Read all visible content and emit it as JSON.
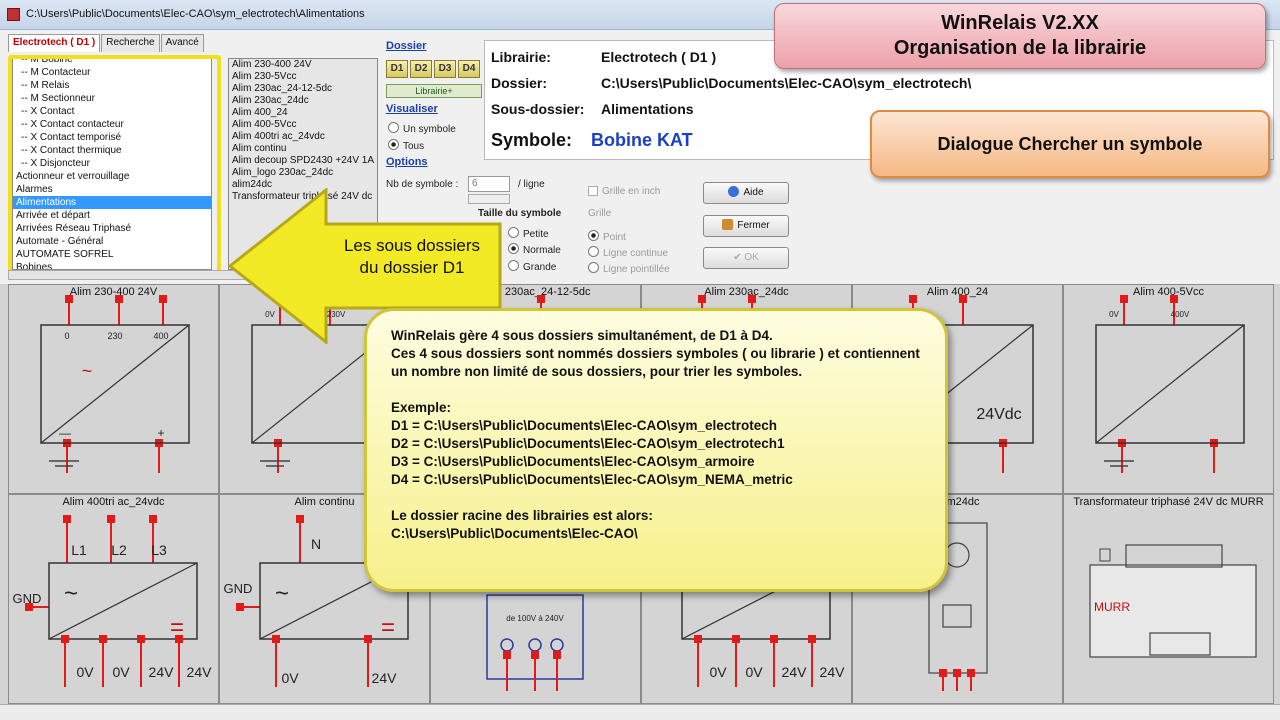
{
  "window": {
    "title": "C:\\Users\\Public\\Documents\\Elec-CAO\\sym_electrotech\\Alimentations"
  },
  "tabs": [
    {
      "label": "Electrotech ( D1 )"
    },
    {
      "label": "Recherche"
    },
    {
      "label": "Avancé"
    }
  ],
  "tree": {
    "items": [
      {
        "label": "-- M Bobine",
        "indent": true
      },
      {
        "label": "-- M Contacteur",
        "indent": true
      },
      {
        "label": "-- M Relais",
        "indent": true
      },
      {
        "label": "-- M Sectionneur",
        "indent": true
      },
      {
        "label": "-- X Contact",
        "indent": true
      },
      {
        "label": "-- X Contact contacteur",
        "indent": true
      },
      {
        "label": "-- X Contact temporisé",
        "indent": true
      },
      {
        "label": "-- X Contact thermique",
        "indent": true
      },
      {
        "label": "-- X Disjoncteur",
        "indent": true
      },
      {
        "label": "Actionneur et verrouillage",
        "indent": false
      },
      {
        "label": "Alarmes",
        "indent": false
      },
      {
        "label": "Alimentations",
        "indent": false,
        "selected": true
      },
      {
        "label": "Arrivée et départ",
        "indent": false
      },
      {
        "label": "Arrivées Réseau Triphasé",
        "indent": false
      },
      {
        "label": "Automate - Général",
        "indent": false
      },
      {
        "label": "AUTOMATE SOFREL",
        "indent": false
      },
      {
        "label": "Bobines",
        "indent": false
      }
    ]
  },
  "symbol_list": [
    "Alim 230-400 24V",
    "Alim 230-5Vcc",
    "Alim 230ac_24-12-5dc",
    "Alim 230ac_24dc",
    "Alim 400_24",
    "Alim 400-5Vcc",
    "Alim 400tri ac_24vdc",
    "Alim continu",
    "Alim decoup SPD2430 +24V 1A",
    "Alim_logo 230ac_24dc",
    "alim24dc",
    "Transformateur triphasé 24V dc"
  ],
  "dossier": {
    "label": "Dossier",
    "buttons": [
      "D1",
      "D2",
      "D3",
      "D4"
    ],
    "librairie_button": "Librairie+"
  },
  "visualiser": {
    "label": "Visualiser",
    "options": [
      {
        "label": "Un symbole",
        "on": false
      },
      {
        "label": "Tous",
        "on": true
      }
    ]
  },
  "options": {
    "label": "Options",
    "nb_label": "Nb de symbole :",
    "nb_value": "6",
    "per_line": "/ ligne",
    "grid_inch": "Grille en inch",
    "grid_label": "Grille",
    "size_label": "Taille du symbole",
    "sizes": [
      {
        "label": "Petite",
        "on": false
      },
      {
        "label": "Normale",
        "on": true
      },
      {
        "label": "Grande",
        "on": false
      }
    ],
    "grid_styles": [
      {
        "label": "Point",
        "on": true
      },
      {
        "label": "Ligne continue",
        "on": false
      },
      {
        "label": "Ligne pointillée",
        "on": false
      }
    ]
  },
  "buttons": {
    "aide": "Aide",
    "fermer": "Fermer",
    "ok": "OK"
  },
  "info": {
    "librairie_label": "Librairie:",
    "librairie_value": "Electrotech ( D1 )",
    "dossier_label": "Dossier:",
    "dossier_value": "C:\\Users\\Public\\Documents\\Elec-CAO\\sym_electrotech\\",
    "sous_label": "Sous-dossier:",
    "sous_value": "Alimentations",
    "symbole_label": "Symbole:",
    "symbole_value": "Bobine KAT"
  },
  "overlay": {
    "title_line1": "WinRelais V2.XX",
    "title_line2": "Organisation de la librairie",
    "subtitle": "Dialogue Chercher un symbole",
    "arrow_line1": "Les sous dossiers",
    "arrow_line2": "du dossier D1",
    "note": {
      "p1": "WinRelais gère 4 sous dossiers simultanément, de D1 à D4.",
      "p2": "Ces 4 sous dossiers sont nommés dossiers symboles ( ou librarie ) et contiennent un nombre non limité de sous dossiers, pour trier les symboles.",
      "example": "Exemple:",
      "d1": "D1 = C:\\Users\\Public\\Documents\\Elec-CAO\\sym_electrotech",
      "d2": "D2 = C:\\Users\\Public\\Documents\\Elec-CAO\\sym_electrotech1",
      "d3": "D3 = C:\\Users\\Public\\Documents\\Elec-CAO\\sym_armoire",
      "d4": "D4 = C:\\Users\\Public\\Documents\\Elec-CAO\\sym_NEMA_metric",
      "root": "Le dossier racine des librairies est alors:",
      "root_path": "C:\\Users\\Public\\Documents\\Elec-CAO\\"
    }
  },
  "cells": [
    {
      "title": "Alim 230-400 24V",
      "labels": [
        "0",
        "230",
        "400",
        "~",
        "—",
        "+"
      ]
    },
    {
      "title": "Alim 230-5Vcc",
      "labels": [
        "0V",
        "230V"
      ]
    },
    {
      "title": "Alim 230ac_24-12-5dc",
      "labels": []
    },
    {
      "title": "Alim 230ac_24dc",
      "labels": []
    },
    {
      "title": "Alim 400_24",
      "labels": [
        "24Vdc"
      ]
    },
    {
      "title": "Alim 400-5Vcc",
      "labels": [
        "0V",
        "400V"
      ]
    },
    {
      "title": "Alim 400tri ac_24vdc",
      "labels": [
        "L1",
        "L2",
        "L3",
        "GND",
        "~",
        "=",
        "0V",
        "0V",
        "24V",
        "24V"
      ]
    },
    {
      "title": "Alim continu",
      "labels": [
        "N",
        "GND",
        "~",
        "=",
        "0V",
        "24V"
      ]
    },
    {
      "title": "",
      "labels": [
        "de 100V à 240V"
      ]
    },
    {
      "title": "",
      "labels": [
        "0V",
        "0V",
        "24V",
        "24V"
      ]
    },
    {
      "title": "alim24dc",
      "labels": []
    },
    {
      "title": "Transformateur triphasé 24V dc MURR",
      "labels": [
        "MURR"
      ]
    }
  ]
}
